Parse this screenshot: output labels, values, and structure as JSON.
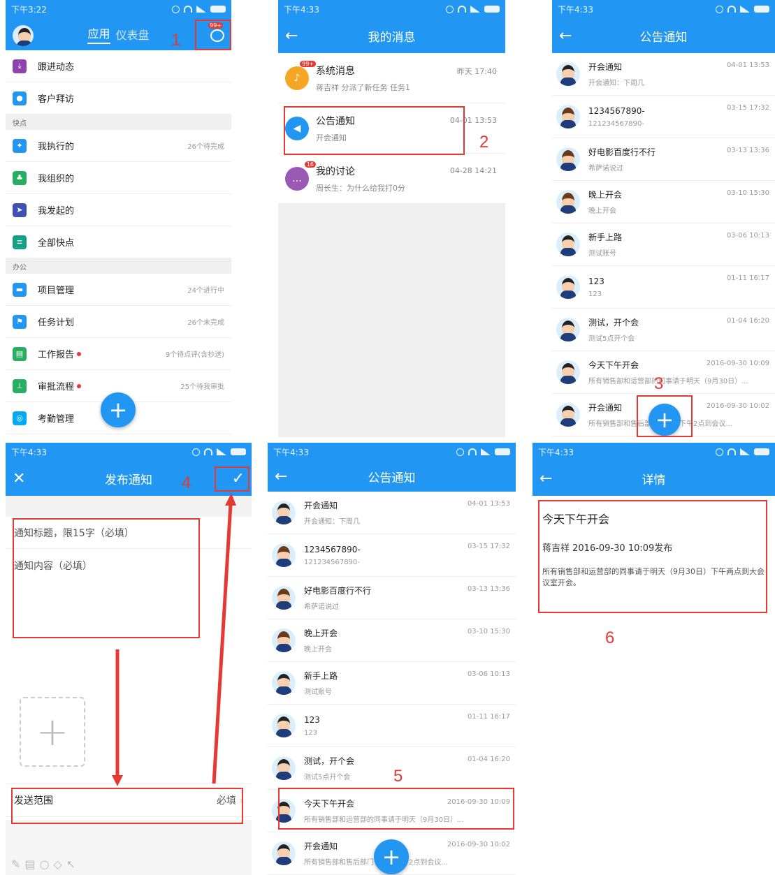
{
  "p1": {
    "time": "下午3:22",
    "tab_apps": "应用",
    "tab_dashboard": "仪表盘",
    "chat_badge": "99+",
    "step": "1",
    "rows_top": [
      {
        "label": "跟进动态",
        "color": "#8e44ad"
      },
      {
        "label": "客户拜访",
        "color": "#2196f3"
      }
    ],
    "section_quick": "快点",
    "rows_quick": [
      {
        "label": "我执行的",
        "meta": "26个待完成",
        "color": "#2196f3"
      },
      {
        "label": "我组织的",
        "meta": "",
        "color": "#27ae60"
      },
      {
        "label": "我发起的",
        "meta": "",
        "color": "#3f51b5"
      },
      {
        "label": "全部快点",
        "meta": "",
        "color": "#16a085"
      }
    ],
    "section_office": "办公",
    "rows_office": [
      {
        "label": "项目管理",
        "meta": "24个进行中",
        "color": "#2196f3"
      },
      {
        "label": "任务计划",
        "meta": "26个未完成",
        "color": "#2196f3"
      },
      {
        "label": "工作报告",
        "meta": "9个待点评(含抄送)",
        "color": "#27ae60"
      },
      {
        "label": "审批流程",
        "meta": "25个待我审批",
        "color": "#27ae60"
      },
      {
        "label": "考勤管理",
        "meta": "",
        "color": "#03a9f4"
      }
    ]
  },
  "p2": {
    "time": "下午4:33",
    "title": "我的消息",
    "step": "2",
    "items": [
      {
        "title": "系统消息",
        "sub": "蒋吉祥 分派了新任务 任务1",
        "time": "昨天 17:40",
        "badge": "99+",
        "color": "#f5a623"
      },
      {
        "title": "公告通知",
        "sub": "开会通知",
        "time": "04-01 13:53",
        "badge": "",
        "color": "#2196f3"
      },
      {
        "title": "我的讨论",
        "sub": "周长生：为什么给我打0分",
        "time": "04-28 14:21",
        "badge": "16",
        "color": "#9b59b6"
      }
    ]
  },
  "notices": [
    {
      "title": "开会通知",
      "sub": "开会通知：下周几",
      "time": "04-01 13:53",
      "female": false
    },
    {
      "title": "1234567890-",
      "sub": "121234567890-",
      "time": "03-15 17:32",
      "female": true
    },
    {
      "title": "好电影百度行不行",
      "sub": "希萨诺说过",
      "time": "03-13 13:36",
      "female": true
    },
    {
      "title": "晚上开会",
      "sub": "晚上开会",
      "time": "03-10 15:30",
      "female": true
    },
    {
      "title": "新手上路",
      "sub": "测试账号",
      "time": "03-06 10:13",
      "female": false
    },
    {
      "title": "123",
      "sub": "123",
      "time": "01-11 16:17",
      "female": false
    },
    {
      "title": "测试，开个会",
      "sub": "测试5点开个会",
      "time": "01-04 16:20",
      "female": false
    },
    {
      "title": "今天下午开会",
      "sub": "所有销售部和运营部的同事请于明天（9月30日）...",
      "time": "2016-09-30 10:09",
      "female": false
    },
    {
      "title": "开会通知",
      "sub": "所有销售部和售后部门于今天下午2点到会议...",
      "time": "2016-09-30 10:02",
      "female": false
    }
  ],
  "p3": {
    "time": "下午4:33",
    "title": "公告通知",
    "step": "3"
  },
  "p4": {
    "time": "下午4:33",
    "title": "发布通知",
    "step": "4",
    "title_placeholder": "通知标题，限15字（必填）",
    "content_placeholder": "通知内容（必填）",
    "scope_label": "发送范围",
    "scope_required": "必填"
  },
  "p5": {
    "time": "下午4:33",
    "title": "公告通知",
    "step": "5"
  },
  "p6": {
    "time": "下午4:33",
    "title": "详情",
    "step": "6",
    "notice_title": "今天下午开会",
    "byline": "蒋吉祥  2016-09-30 10:09发布",
    "body": "所有销售部和运营部的同事请于明天（9月30日）下午两点到大会议室开会。"
  }
}
